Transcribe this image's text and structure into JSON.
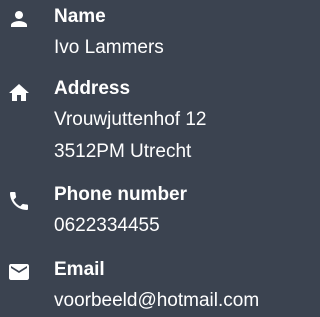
{
  "contact": {
    "name": {
      "icon": "person-icon",
      "label": "Name",
      "value": "Ivo Lammers"
    },
    "address": {
      "icon": "home-icon",
      "label": "Address",
      "lines": [
        "Vrouwjuttenhof 12",
        "3512PM Utrecht"
      ]
    },
    "phone": {
      "icon": "phone-icon",
      "label": "Phone number",
      "value": "0622334455"
    },
    "email": {
      "icon": "mail-icon",
      "label": "Email",
      "value": "voorbeeld@hotmail.com"
    }
  },
  "colors": {
    "background": "#3b4350",
    "text": "#ffffff"
  }
}
